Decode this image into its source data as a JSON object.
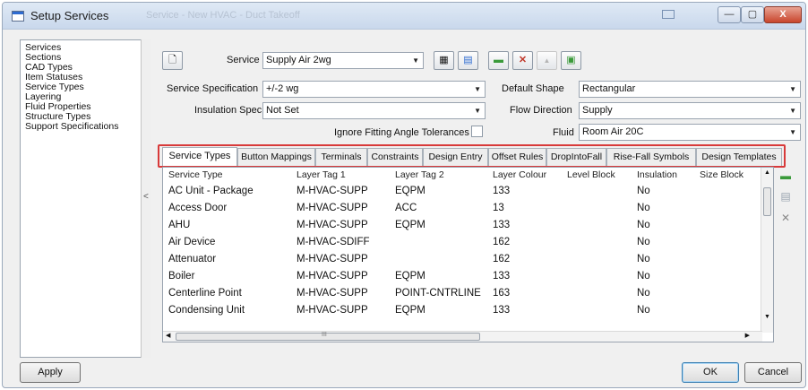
{
  "window": {
    "title": "Setup Services",
    "ghost_title": "Service - New HVAC - Duct Takeoff",
    "min_glyph": "—",
    "max_glyph": "▢",
    "close_glyph": "X"
  },
  "nav": {
    "items": [
      "Services",
      "Sections",
      "CAD Types",
      "Item Statuses",
      "Service Types",
      "Layering",
      "Fluid Properties",
      "Structure Types",
      "Support Specifications"
    ],
    "collapse_glyph": "<"
  },
  "form": {
    "service_label": "Service",
    "service_value": "Supply Air  2wg",
    "spec_label": "Service Specification",
    "spec_value": "+/-2 wg",
    "insulation_label": "Insulation Spec",
    "insulation_value": "Not Set",
    "ignore_label": "Ignore Fitting Angle Tolerances",
    "default_shape_label": "Default Shape",
    "default_shape_value": "Rectangular",
    "flow_label": "Flow Direction",
    "flow_value": "Supply",
    "fluid_label": "Fluid",
    "fluid_value": "Room Air 20C"
  },
  "toolbar": {
    "dropdown_glyph": "▼",
    "preview_glyph": "🗋",
    "props_glyph": "▦",
    "edit_glyph": "▤",
    "add_glyph": "▬",
    "delete_glyph": "✕",
    "up_glyph": "▲",
    "save_glyph": "▣"
  },
  "tabs": [
    "Service Types",
    "Button Mappings",
    "Terminals",
    "Constraints",
    "Design Entry",
    "Offset Rules",
    "DropIntoFall",
    "Rise-Fall Symbols",
    "Design Templates"
  ],
  "table": {
    "columns": [
      "Service Type",
      "Layer Tag 1",
      "Layer Tag 2",
      "Layer Colour",
      "Level Block",
      "Insulation",
      "Size Block"
    ],
    "rows": [
      [
        "AC Unit - Package",
        "M-HVAC-SUPP",
        "EQPM",
        "133",
        "",
        "No",
        ""
      ],
      [
        "Access Door",
        "M-HVAC-SUPP",
        "ACC",
        "13",
        "",
        "No",
        ""
      ],
      [
        "AHU",
        "M-HVAC-SUPP",
        "EQPM",
        "133",
        "",
        "No",
        ""
      ],
      [
        "Air Device",
        "M-HVAC-SDIFF",
        "",
        "162",
        "",
        "No",
        ""
      ],
      [
        "Attenuator",
        "M-HVAC-SUPP",
        "",
        "162",
        "",
        "No",
        ""
      ],
      [
        "Boiler",
        "M-HVAC-SUPP",
        "EQPM",
        "133",
        "",
        "No",
        ""
      ],
      [
        "Centerline Point",
        "M-HVAC-SUPP",
        "POINT-CNTRLINE",
        "163",
        "",
        "No",
        ""
      ],
      [
        "Condensing Unit",
        "M-HVAC-SUPP",
        "EQPM",
        "133",
        "",
        "No",
        ""
      ]
    ],
    "scroll_up": "▲",
    "scroll_down": "▼",
    "scroll_left": "◀",
    "scroll_right": "▶",
    "hscroll_grip": "III"
  },
  "side_tools": {
    "add_glyph": "▬",
    "edit_glyph": "▤",
    "delete_glyph": "✕"
  },
  "buttons": {
    "apply": "Apply",
    "ok": "OK",
    "cancel": "Cancel"
  },
  "colors": {
    "highlight": "#d83a3a",
    "close_button": "#c8452c",
    "green_icon": "#3a9a3a",
    "red_icon": "#c0392b"
  }
}
